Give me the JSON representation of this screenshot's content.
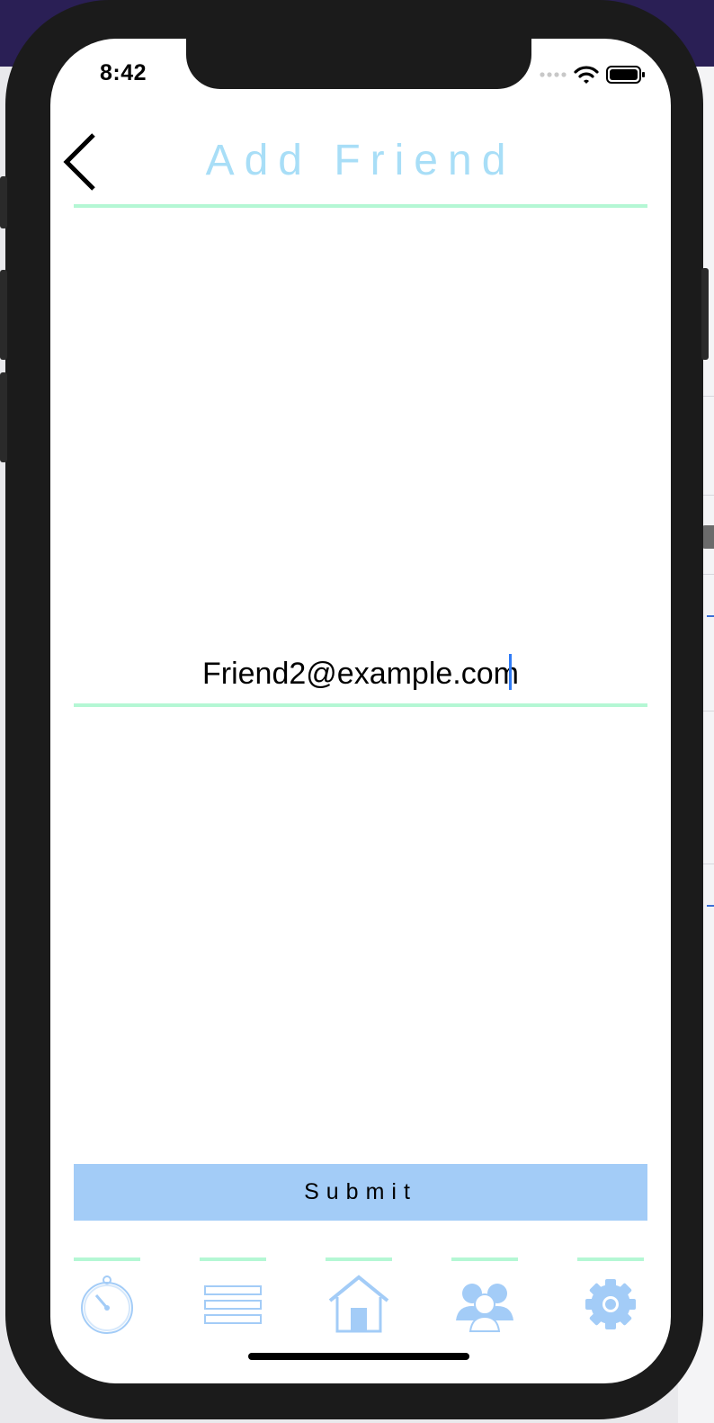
{
  "status_bar": {
    "time": "8:42"
  },
  "header": {
    "title": "Add Friend",
    "back_icon": "chevron-left-icon"
  },
  "form": {
    "email_value": "Friend2@example.com"
  },
  "actions": {
    "submit_label": "Submit"
  },
  "tab_bar": {
    "tabs": [
      {
        "icon": "stopwatch-icon"
      },
      {
        "icon": "list-icon"
      },
      {
        "icon": "home-icon"
      },
      {
        "icon": "friends-icon"
      },
      {
        "icon": "gear-icon"
      }
    ]
  },
  "colors": {
    "title": "#a8def7",
    "rule": "#b4f7d4",
    "submit_bg": "#a3ccf7",
    "icon": "#a3ccf7",
    "caret": "#2f7bf6"
  }
}
